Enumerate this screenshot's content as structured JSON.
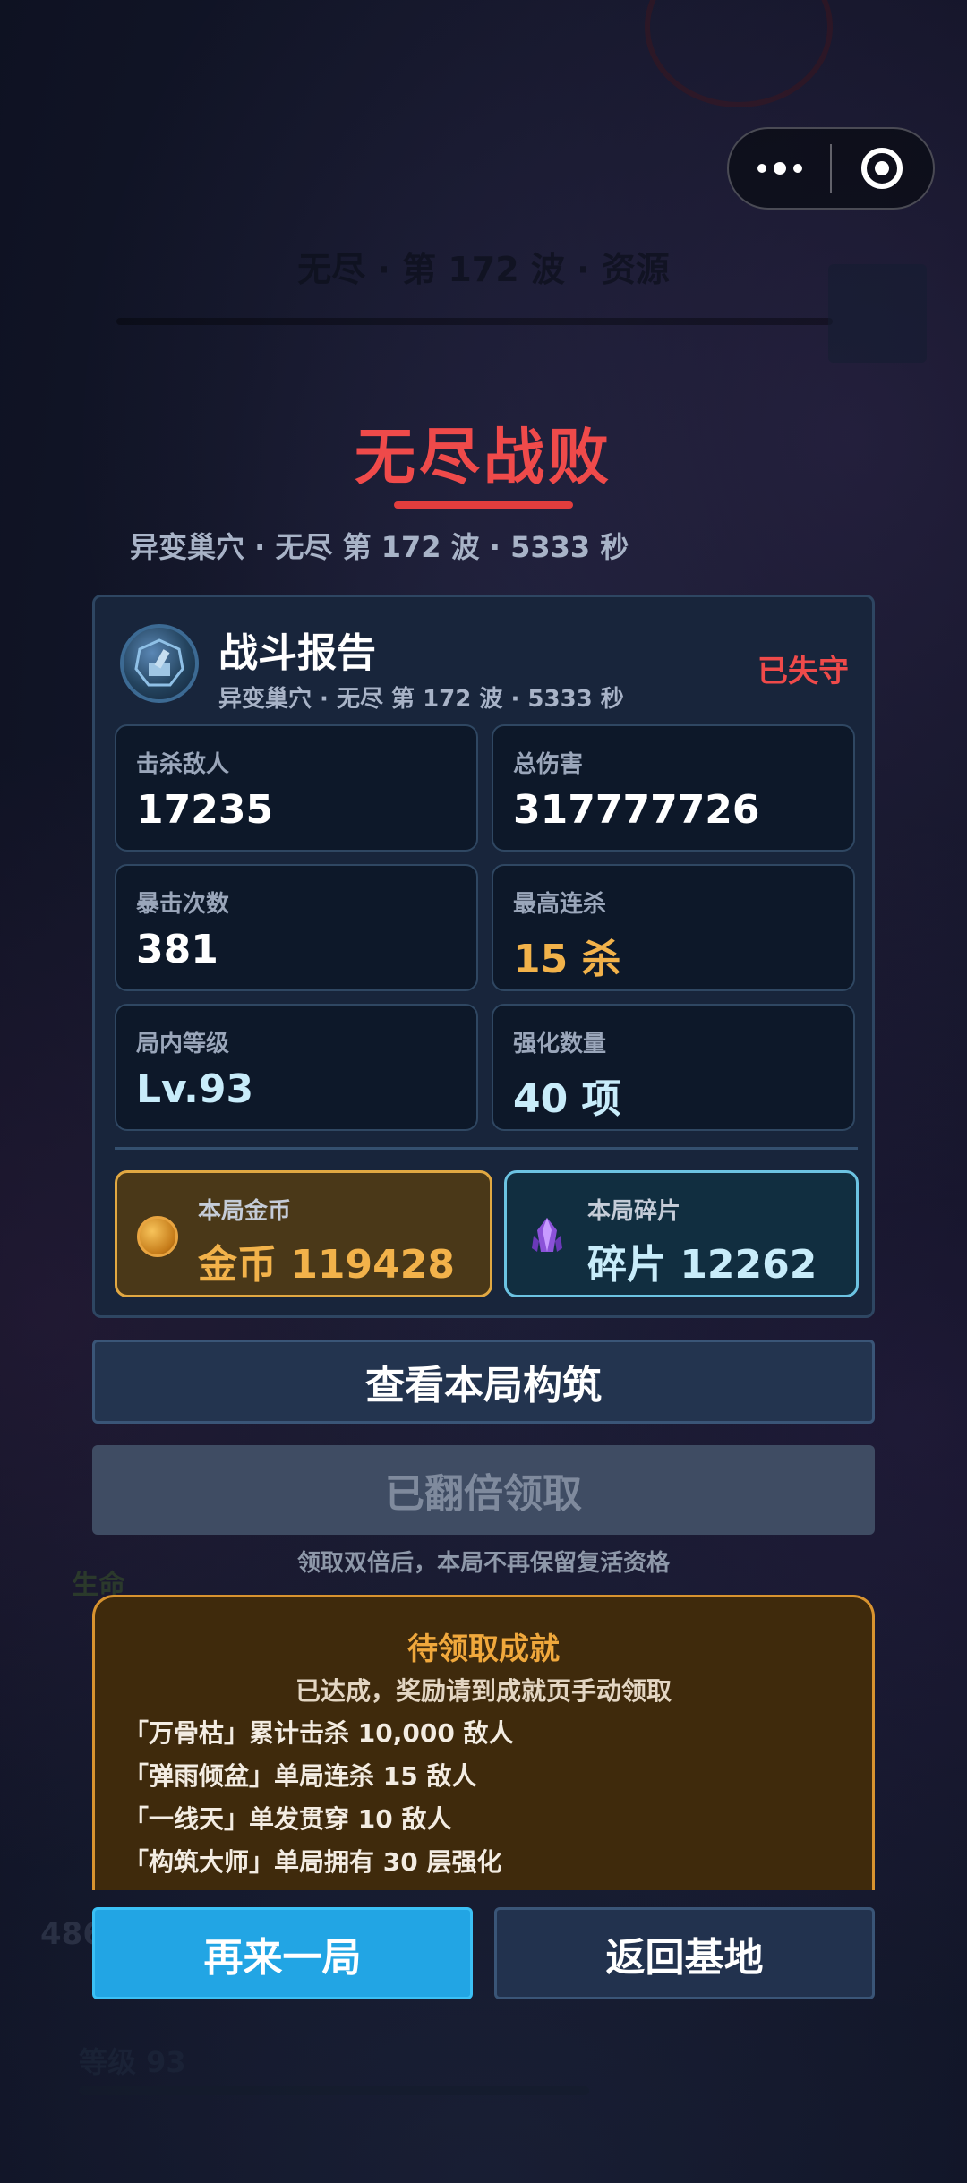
{
  "hud": {
    "ghost_title": "无尽 · 第 172 波 · 资源",
    "ghost_left_label": "生命",
    "ghost_left_number": "486",
    "ghost_level": "等级 93"
  },
  "result": {
    "title": "无尽战败",
    "subtitle": "异变巢穴 · 无尽 第 172 波 · 5333 秒"
  },
  "report": {
    "title": "战斗报告",
    "subtitle": "异变巢穴 · 无尽 第 172 波 · 5333 秒",
    "status": "已失守",
    "stats": [
      {
        "label": "击杀敌人",
        "value": "17235",
        "color": "#ffffff"
      },
      {
        "label": "总伤害",
        "value": "317777726",
        "color": "#ffffff"
      },
      {
        "label": "暴击次数",
        "value": "381",
        "color": "#ffffff"
      },
      {
        "label": "最高连杀",
        "value": "15 杀",
        "color": "#f2b24a"
      },
      {
        "label": "局内等级",
        "value": "Lv.93",
        "color": "#c8ecfa"
      },
      {
        "label": "强化数量",
        "value": "40 项",
        "color": "#c8ecfa"
      }
    ],
    "gold": {
      "label": "本局金币",
      "value": "金币  119428",
      "icon": "coin-icon"
    },
    "shard": {
      "label": "本局碎片",
      "value": "碎片  12262",
      "icon": "crystal-icon"
    }
  },
  "buttons": {
    "build": "查看本局构筑",
    "double_claimed": "已翻倍领取",
    "double_note": "领取双倍后，本局不再保留复活资格",
    "again": "再来一局",
    "base": "返回基地"
  },
  "achievements": {
    "title": "待领取成就",
    "subtitle": "已达成，奖励请到成就页手动领取",
    "items": [
      "「万骨枯」累计击杀 10,000 敌人",
      "「弹雨倾盆」单局连杀 15 敌人",
      "「一线天」单发贯穿 10 敌人",
      "「构筑大师」单局拥有 30 层强化"
    ]
  },
  "colors": {
    "defeat_red": "#ef4a4a",
    "gold": "#f2b24a",
    "accent_blue": "#22a5e4",
    "panel_bg": "#18253b"
  }
}
